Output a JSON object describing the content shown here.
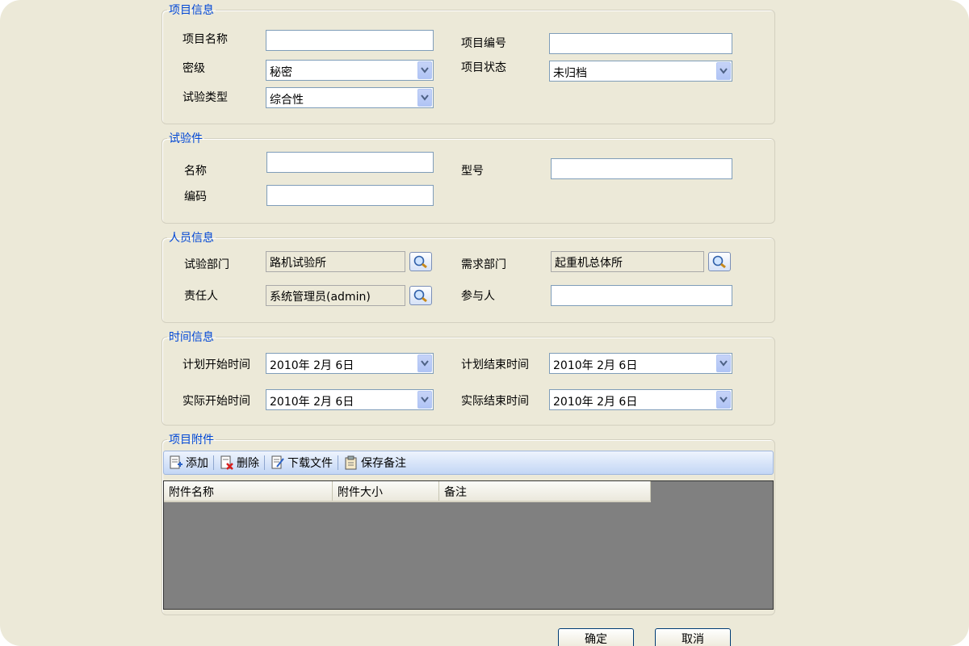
{
  "project_info": {
    "legend": "项目信息",
    "name_label": "项目名称",
    "name_value": "",
    "number_label": "项目编号",
    "number_value": "",
    "secret_label": "密级",
    "secret_value": "秘密",
    "status_label": "项目状态",
    "status_value": "未归档",
    "test_type_label": "试验类型",
    "test_type_value": "综合性"
  },
  "test_piece": {
    "legend": "试验件",
    "name_label": "名称",
    "name_value": "",
    "model_label": "型号",
    "model_value": "",
    "code_label": "编码",
    "code_value": ""
  },
  "personnel": {
    "legend": "人员信息",
    "test_dept_label": "试验部门",
    "test_dept_value": "路机试验所",
    "demand_dept_label": "需求部门",
    "demand_dept_value": "起重机总体所",
    "owner_label": "责任人",
    "owner_value": "系统管理员(admin)",
    "participants_label": "参与人",
    "participants_value": ""
  },
  "time_info": {
    "legend": "时间信息",
    "plan_start_label": "计划开始时间",
    "plan_start_value": "2010年 2月 6日",
    "plan_end_label": "计划结束时间",
    "plan_end_value": "2010年 2月 6日",
    "actual_start_label": "实际开始时间",
    "actual_start_value": "2010年 2月 6日",
    "actual_end_label": "实际结束时间",
    "actual_end_value": "2010年 2月 6日"
  },
  "attachments": {
    "legend": "项目附件",
    "toolbar": {
      "add": "添加",
      "delete": "删除",
      "download": "下载文件",
      "save_note": "保存备注"
    },
    "columns": [
      "附件名称",
      "附件大小",
      "备注"
    ],
    "rows": []
  },
  "footer": {
    "ok": "确定",
    "cancel": "取消"
  },
  "colors": {
    "window_bg": "#ece9d8",
    "legend_text": "#0046d5",
    "grid_bg": "#808080"
  }
}
